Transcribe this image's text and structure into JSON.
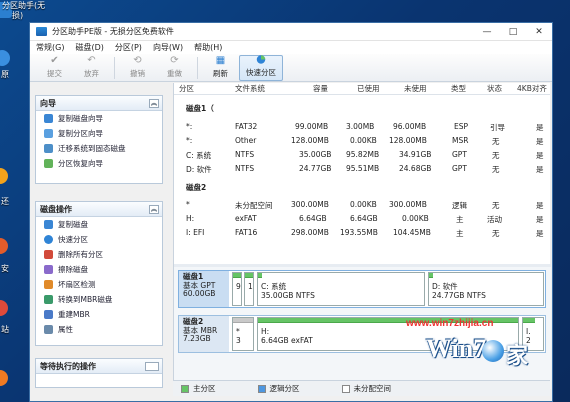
{
  "desktop": {
    "labels": [
      "分区助手(无",
      "损)",
      "原",
      "还",
      "安",
      "站"
    ]
  },
  "window": {
    "title": "分区助手PE版 - 无损分区免费软件",
    "controls": [
      "—",
      "□",
      "✕"
    ]
  },
  "menu": [
    "常规(G)",
    "磁盘(D)",
    "分区(P)",
    "向导(W)",
    "帮助(H)"
  ],
  "toolbar": [
    {
      "label": "提交",
      "icon": "check-icon",
      "state": "gray"
    },
    {
      "label": "放弃",
      "icon": "discard-icon",
      "state": "gray"
    },
    {
      "label": "撤销",
      "icon": "undo-icon",
      "state": "gray"
    },
    {
      "label": "重做",
      "icon": "redo-icon",
      "state": "gray"
    },
    {
      "label": "刷新",
      "icon": "refresh-icon",
      "state": "active"
    },
    {
      "label": "快速分区",
      "icon": "quick-partition-icon",
      "state": "selected"
    }
  ],
  "left": {
    "wizard": {
      "title": "向导",
      "items": [
        "复制磁盘向导",
        "复制分区向导",
        "迁移系统到固态磁盘",
        "分区恢复向导"
      ]
    },
    "disk_ops": {
      "title": "磁盘操作",
      "items": [
        "复制磁盘",
        "快速分区",
        "删除所有分区",
        "擦除磁盘",
        "坏扇区检测",
        "转换到MBR磁盘",
        "重建MBR",
        "属性"
      ]
    },
    "pending": {
      "title": "等待执行的操作"
    }
  },
  "table": {
    "headers": [
      "分区",
      "文件系统",
      "容量",
      "已使用",
      "未使用",
      "类型",
      "状态",
      "4KB对齐"
    ],
    "disk1": "磁盘1（",
    "disk2": "磁盘2",
    "rows1": [
      [
        "*:",
        "FAT32",
        "99.00MB",
        "3.00MB",
        "96.00MB",
        "ESP",
        "引导",
        "是"
      ],
      [
        "*:",
        "Other",
        "128.00MB",
        "0.00KB",
        "128.00MB",
        "MSR",
        "无",
        "是"
      ],
      [
        "C: 系统",
        "NTFS",
        "35.00GB",
        "95.82MB",
        "34.91GB",
        "GPT",
        "无",
        "是"
      ],
      [
        "D: 软件",
        "NTFS",
        "24.77GB",
        "95.51MB",
        "24.68GB",
        "GPT",
        "无",
        "是"
      ]
    ],
    "rows2": [
      [
        "*",
        "未分配空间",
        "300.00MB",
        "0.00KB",
        "300.00MB",
        "逻辑",
        "无",
        "是"
      ],
      [
        "H:",
        "exFAT",
        "6.64GB",
        "6.64GB",
        "0.00KB",
        "主",
        "活动",
        "是"
      ],
      [
        "I: EFI",
        "FAT16",
        "298.00MB",
        "193.55MB",
        "104.45MB",
        "主",
        "无",
        "是"
      ]
    ]
  },
  "maps": {
    "disk1": {
      "name": "磁盘1",
      "type": "基本 GPT",
      "size": "60.00GB",
      "p1": "9",
      "p2": "1",
      "c_name": "C: 系统",
      "c_info": "35.00GB NTFS",
      "d_name": "D: 软件",
      "d_info": "24.77GB NTFS"
    },
    "disk2": {
      "name": "磁盘2",
      "type": "基本 MBR",
      "size": "7.23GB",
      "u1": "*",
      "u2": "3",
      "h_name": "H:",
      "h_info": "6.64GB exFAT",
      "i_name": "I.",
      "i_info": "2"
    }
  },
  "legend": [
    "主分区",
    "逻辑分区",
    "未分配空间"
  ],
  "watermark": {
    "url": "www.win7zhijia.cn",
    "brand": "Win7",
    "suffix": "家"
  },
  "colors": {
    "primary": "#66c466",
    "logical": "#4e97e0",
    "unallocated": "#ffffff",
    "accent": "#1b62b0"
  }
}
